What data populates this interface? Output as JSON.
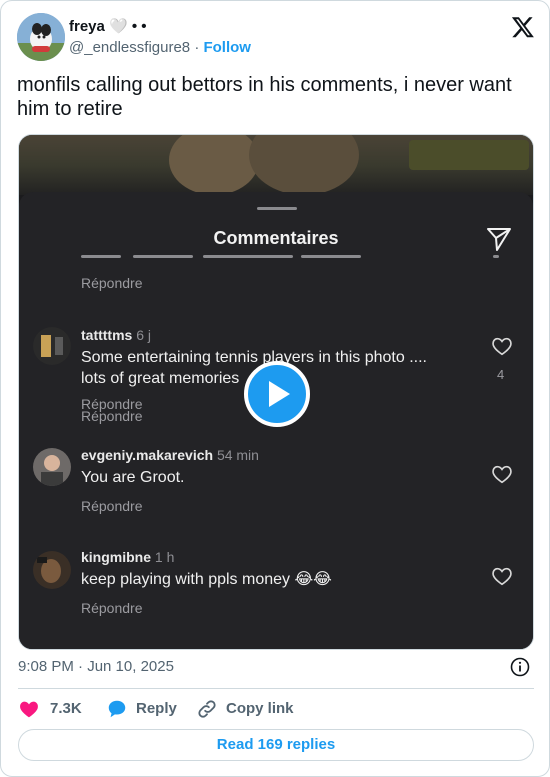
{
  "author": {
    "display_name": "freya 🤍 • •",
    "handle": "@_endlessfigure8",
    "separator": "·",
    "follow_label": "Follow"
  },
  "tweet": {
    "text": "monfils calling out bettors in his comments, i never want him to retire"
  },
  "media": {
    "sheet_title": "Commentaires",
    "reply_label": "Répondre",
    "comments": [
      {
        "user": "tattttms",
        "time": "6 j",
        "lines": [
          "Some entertaining tennis players in this photo ....",
          "lots of great memories"
        ],
        "likes": "4"
      },
      {
        "user": "evgeniy.makarevich",
        "time": "54 min",
        "lines": [
          "You are Groot."
        ],
        "likes": ""
      },
      {
        "user": "kingmibne",
        "time": "1 h",
        "lines": [
          "keep playing with ppls money 😂😂"
        ],
        "likes": ""
      }
    ]
  },
  "meta": {
    "timestamp": "9:08 PM · Jun 10, 2025"
  },
  "actions": {
    "likes": "7.3K",
    "reply_label": "Reply",
    "copy_label": "Copy link"
  },
  "read_replies_label": "Read 169 replies",
  "colors": {
    "accent": "#1d9bf0",
    "heart": "#f91880",
    "secondary_text": "#536471"
  }
}
